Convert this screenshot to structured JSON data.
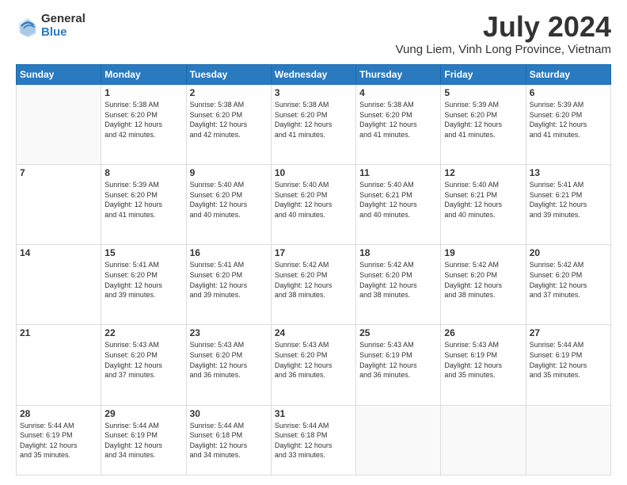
{
  "logo": {
    "general": "General",
    "blue": "Blue"
  },
  "header": {
    "month": "July 2024",
    "location": "Vung Liem, Vinh Long Province, Vietnam"
  },
  "days_of_week": [
    "Sunday",
    "Monday",
    "Tuesday",
    "Wednesday",
    "Thursday",
    "Friday",
    "Saturday"
  ],
  "weeks": [
    [
      {
        "day": "",
        "info": ""
      },
      {
        "day": "1",
        "info": "Sunrise: 5:38 AM\nSunset: 6:20 PM\nDaylight: 12 hours\nand 42 minutes."
      },
      {
        "day": "2",
        "info": "Sunrise: 5:38 AM\nSunset: 6:20 PM\nDaylight: 12 hours\nand 42 minutes."
      },
      {
        "day": "3",
        "info": "Sunrise: 5:38 AM\nSunset: 6:20 PM\nDaylight: 12 hours\nand 41 minutes."
      },
      {
        "day": "4",
        "info": "Sunrise: 5:38 AM\nSunset: 6:20 PM\nDaylight: 12 hours\nand 41 minutes."
      },
      {
        "day": "5",
        "info": "Sunrise: 5:39 AM\nSunset: 6:20 PM\nDaylight: 12 hours\nand 41 minutes."
      },
      {
        "day": "6",
        "info": "Sunrise: 5:39 AM\nSunset: 6:20 PM\nDaylight: 12 hours\nand 41 minutes."
      }
    ],
    [
      {
        "day": "7",
        "info": ""
      },
      {
        "day": "8",
        "info": "Sunrise: 5:39 AM\nSunset: 6:20 PM\nDaylight: 12 hours\nand 41 minutes."
      },
      {
        "day": "9",
        "info": "Sunrise: 5:40 AM\nSunset: 6:20 PM\nDaylight: 12 hours\nand 40 minutes."
      },
      {
        "day": "10",
        "info": "Sunrise: 5:40 AM\nSunset: 6:20 PM\nDaylight: 12 hours\nand 40 minutes."
      },
      {
        "day": "11",
        "info": "Sunrise: 5:40 AM\nSunset: 6:21 PM\nDaylight: 12 hours\nand 40 minutes."
      },
      {
        "day": "12",
        "info": "Sunrise: 5:40 AM\nSunset: 6:21 PM\nDaylight: 12 hours\nand 40 minutes."
      },
      {
        "day": "13",
        "info": "Sunrise: 5:41 AM\nSunset: 6:21 PM\nDaylight: 12 hours\nand 39 minutes."
      }
    ],
    [
      {
        "day": "14",
        "info": ""
      },
      {
        "day": "15",
        "info": "Sunrise: 5:41 AM\nSunset: 6:20 PM\nDaylight: 12 hours\nand 39 minutes."
      },
      {
        "day": "16",
        "info": "Sunrise: 5:41 AM\nSunset: 6:20 PM\nDaylight: 12 hours\nand 39 minutes."
      },
      {
        "day": "17",
        "info": "Sunrise: 5:42 AM\nSunset: 6:20 PM\nDaylight: 12 hours\nand 38 minutes."
      },
      {
        "day": "18",
        "info": "Sunrise: 5:42 AM\nSunset: 6:20 PM\nDaylight: 12 hours\nand 38 minutes."
      },
      {
        "day": "19",
        "info": "Sunrise: 5:42 AM\nSunset: 6:20 PM\nDaylight: 12 hours\nand 38 minutes."
      },
      {
        "day": "20",
        "info": "Sunrise: 5:42 AM\nSunset: 6:20 PM\nDaylight: 12 hours\nand 37 minutes."
      }
    ],
    [
      {
        "day": "21",
        "info": ""
      },
      {
        "day": "22",
        "info": "Sunrise: 5:43 AM\nSunset: 6:20 PM\nDaylight: 12 hours\nand 37 minutes."
      },
      {
        "day": "23",
        "info": "Sunrise: 5:43 AM\nSunset: 6:20 PM\nDaylight: 12 hours\nand 36 minutes."
      },
      {
        "day": "24",
        "info": "Sunrise: 5:43 AM\nSunset: 6:20 PM\nDaylight: 12 hours\nand 36 minutes."
      },
      {
        "day": "25",
        "info": "Sunrise: 5:43 AM\nSunset: 6:19 PM\nDaylight: 12 hours\nand 36 minutes."
      },
      {
        "day": "26",
        "info": "Sunrise: 5:43 AM\nSunset: 6:19 PM\nDaylight: 12 hours\nand 35 minutes."
      },
      {
        "day": "27",
        "info": "Sunrise: 5:44 AM\nSunset: 6:19 PM\nDaylight: 12 hours\nand 35 minutes."
      }
    ],
    [
      {
        "day": "28",
        "info": "Sunrise: 5:44 AM\nSunset: 6:19 PM\nDaylight: 12 hours\nand 35 minutes."
      },
      {
        "day": "29",
        "info": "Sunrise: 5:44 AM\nSunset: 6:19 PM\nDaylight: 12 hours\nand 34 minutes."
      },
      {
        "day": "30",
        "info": "Sunrise: 5:44 AM\nSunset: 6:18 PM\nDaylight: 12 hours\nand 34 minutes."
      },
      {
        "day": "31",
        "info": "Sunrise: 5:44 AM\nSunset: 6:18 PM\nDaylight: 12 hours\nand 33 minutes."
      },
      {
        "day": "",
        "info": ""
      },
      {
        "day": "",
        "info": ""
      },
      {
        "day": "",
        "info": ""
      }
    ]
  ]
}
